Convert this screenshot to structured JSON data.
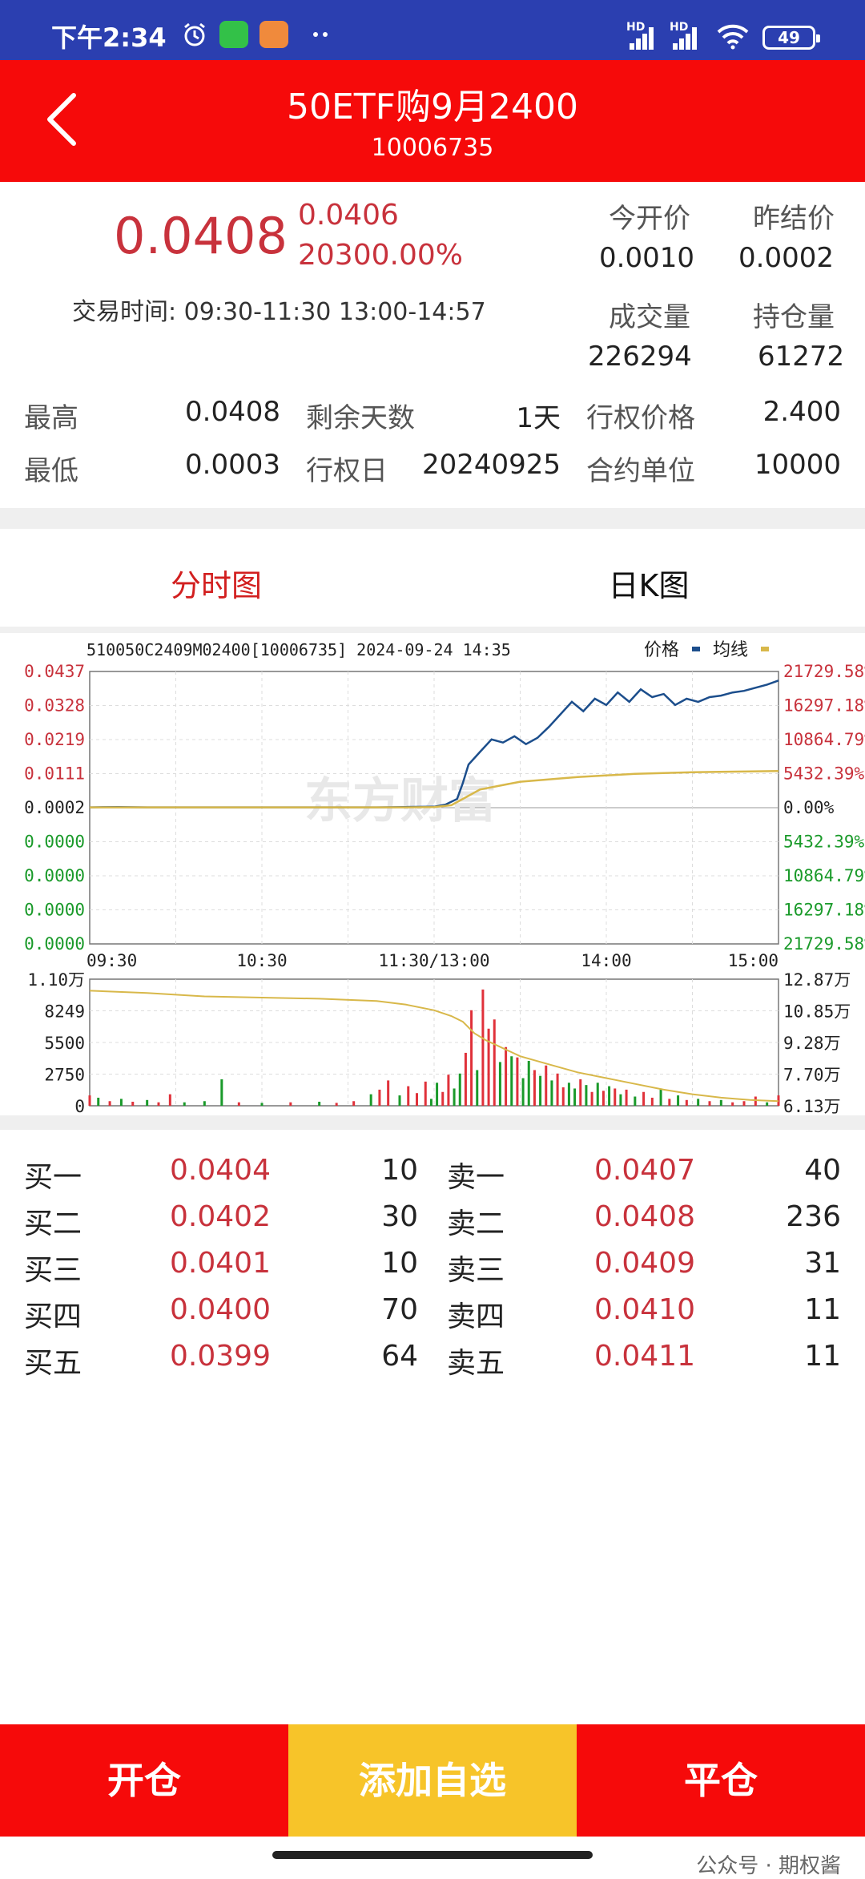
{
  "status_bar": {
    "time": "下午2:34",
    "battery": "49",
    "hd1": "HD",
    "hd2": "HD"
  },
  "header": {
    "title": "50ETF购9月2400",
    "code": "10006735"
  },
  "quote": {
    "price": "0.0408",
    "change": "0.0406",
    "change_pct": "20300.00%",
    "trade_time_label": "交易时间:",
    "trade_time": "09:30-11:30 13:00-14:57",
    "open_label": "今开价",
    "open": "0.0010",
    "prev_settle_label": "昨结价",
    "prev_settle": "0.0002",
    "volume_label": "成交量",
    "volume": "226294",
    "oi_label": "持仓量",
    "oi": "61272",
    "high_label": "最高",
    "high": "0.0408",
    "low_label": "最低",
    "low": "0.0003",
    "days_left_label": "剩余天数",
    "days_left": "1天",
    "exercise_date_label": "行权日",
    "exercise_date": "20240925",
    "strike_label": "行权价格",
    "strike": "2.400",
    "unit_label": "合约单位",
    "unit": "10000"
  },
  "tabs": {
    "intraday": "分时图",
    "daily": "日K图"
  },
  "chart_header": "510050C2409M02400[10006735] 2024-09-24 14:35",
  "legend": {
    "price": "价格",
    "avg": "均线"
  },
  "watermark": "东方财富",
  "chart_data": [
    {
      "type": "line",
      "title": "510050C2409M02400[10006735] 2024-09-24 14:35",
      "x_ticks": [
        "09:30",
        "10:30",
        "11:30/13:00",
        "14:00",
        "15:00"
      ],
      "y_left_ticks": [
        "0.0437",
        "0.0328",
        "0.0219",
        "0.0111",
        "0.0002",
        "0.0000",
        "0.0000",
        "0.0000",
        "0.0000"
      ],
      "y_right_ticks": [
        "21729.58%",
        "16297.18%",
        "10864.79%",
        "5432.39%",
        "0.00%",
        "5432.39%",
        "10864.79%",
        "16297.18%",
        "21729.58%"
      ],
      "ylim": [
        -0.0433,
        0.0437
      ],
      "x_minutes_range": [
        0,
        240
      ],
      "series": [
        {
          "name": "价格",
          "color": "#1c4e8c",
          "x": [
            0,
            10,
            20,
            40,
            60,
            80,
            100,
            110,
            120,
            124,
            128,
            130,
            132,
            136,
            140,
            144,
            148,
            152,
            156,
            160,
            164,
            168,
            172,
            176,
            180,
            184,
            188,
            192,
            196,
            200,
            204,
            208,
            212,
            216,
            220,
            224,
            228,
            232,
            236,
            240
          ],
          "values": [
            0.0003,
            0.0004,
            0.0003,
            0.0003,
            0.0003,
            0.0003,
            0.0003,
            0.0004,
            0.0005,
            0.0012,
            0.003,
            0.008,
            0.014,
            0.018,
            0.022,
            0.021,
            0.023,
            0.0205,
            0.0225,
            0.026,
            0.03,
            0.034,
            0.031,
            0.035,
            0.033,
            0.037,
            0.034,
            0.038,
            0.0355,
            0.0365,
            0.033,
            0.035,
            0.034,
            0.0355,
            0.036,
            0.037,
            0.0375,
            0.0385,
            0.0395,
            0.0408
          ]
        },
        {
          "name": "均线",
          "color": "#d8b84a",
          "x": [
            0,
            40,
            80,
            110,
            120,
            126,
            130,
            136,
            150,
            170,
            190,
            210,
            230,
            240
          ],
          "values": [
            0.0003,
            0.0003,
            0.0003,
            0.0003,
            0.0004,
            0.001,
            0.003,
            0.006,
            0.0085,
            0.01,
            0.011,
            0.0115,
            0.0118,
            0.0119
          ]
        }
      ]
    },
    {
      "type": "bar",
      "y_left_ticks": [
        "1.10万",
        "8249",
        "5500",
        "2750",
        "0"
      ],
      "y_right_ticks": [
        "12.87万",
        "10.85万",
        "9.28万",
        "7.70万",
        "6.13万"
      ],
      "ylim": [
        0,
        11000
      ],
      "bars": [
        {
          "x": 0,
          "v": 900,
          "c": "red"
        },
        {
          "x": 3,
          "v": 700,
          "c": "green"
        },
        {
          "x": 7,
          "v": 400,
          "c": "red"
        },
        {
          "x": 11,
          "v": 600,
          "c": "green"
        },
        {
          "x": 15,
          "v": 350,
          "c": "red"
        },
        {
          "x": 20,
          "v": 500,
          "c": "green"
        },
        {
          "x": 24,
          "v": 300,
          "c": "red"
        },
        {
          "x": 28,
          "v": 1000,
          "c": "red"
        },
        {
          "x": 33,
          "v": 300,
          "c": "green"
        },
        {
          "x": 40,
          "v": 400,
          "c": "green"
        },
        {
          "x": 46,
          "v": 2300,
          "c": "green"
        },
        {
          "x": 52,
          "v": 300,
          "c": "red"
        },
        {
          "x": 60,
          "v": 250,
          "c": "green"
        },
        {
          "x": 70,
          "v": 300,
          "c": "red"
        },
        {
          "x": 80,
          "v": 350,
          "c": "green"
        },
        {
          "x": 86,
          "v": 250,
          "c": "red"
        },
        {
          "x": 92,
          "v": 400,
          "c": "red"
        },
        {
          "x": 98,
          "v": 1000,
          "c": "green"
        },
        {
          "x": 101,
          "v": 1400,
          "c": "red"
        },
        {
          "x": 104,
          "v": 2200,
          "c": "red"
        },
        {
          "x": 108,
          "v": 900,
          "c": "green"
        },
        {
          "x": 111,
          "v": 1700,
          "c": "red"
        },
        {
          "x": 114,
          "v": 1100,
          "c": "red"
        },
        {
          "x": 117,
          "v": 2100,
          "c": "red"
        },
        {
          "x": 119,
          "v": 600,
          "c": "green"
        },
        {
          "x": 121,
          "v": 2000,
          "c": "green"
        },
        {
          "x": 123,
          "v": 1200,
          "c": "red"
        },
        {
          "x": 125,
          "v": 2700,
          "c": "red"
        },
        {
          "x": 127,
          "v": 1500,
          "c": "green"
        },
        {
          "x": 129,
          "v": 2800,
          "c": "green"
        },
        {
          "x": 131,
          "v": 4600,
          "c": "red"
        },
        {
          "x": 133,
          "v": 8300,
          "c": "red"
        },
        {
          "x": 135,
          "v": 3100,
          "c": "green"
        },
        {
          "x": 137,
          "v": 10100,
          "c": "red"
        },
        {
          "x": 139,
          "v": 6700,
          "c": "red"
        },
        {
          "x": 141,
          "v": 7500,
          "c": "red"
        },
        {
          "x": 143,
          "v": 3800,
          "c": "green"
        },
        {
          "x": 145,
          "v": 5100,
          "c": "red"
        },
        {
          "x": 147,
          "v": 4300,
          "c": "green"
        },
        {
          "x": 149,
          "v": 4200,
          "c": "red"
        },
        {
          "x": 151,
          "v": 2400,
          "c": "green"
        },
        {
          "x": 153,
          "v": 3900,
          "c": "green"
        },
        {
          "x": 155,
          "v": 3100,
          "c": "red"
        },
        {
          "x": 157,
          "v": 2600,
          "c": "green"
        },
        {
          "x": 159,
          "v": 3500,
          "c": "red"
        },
        {
          "x": 161,
          "v": 2200,
          "c": "green"
        },
        {
          "x": 163,
          "v": 2800,
          "c": "red"
        },
        {
          "x": 165,
          "v": 1600,
          "c": "red"
        },
        {
          "x": 167,
          "v": 2000,
          "c": "green"
        },
        {
          "x": 169,
          "v": 1500,
          "c": "green"
        },
        {
          "x": 171,
          "v": 2300,
          "c": "red"
        },
        {
          "x": 173,
          "v": 1800,
          "c": "green"
        },
        {
          "x": 175,
          "v": 1200,
          "c": "red"
        },
        {
          "x": 177,
          "v": 2000,
          "c": "green"
        },
        {
          "x": 179,
          "v": 1300,
          "c": "red"
        },
        {
          "x": 181,
          "v": 1700,
          "c": "green"
        },
        {
          "x": 183,
          "v": 1500,
          "c": "red"
        },
        {
          "x": 185,
          "v": 1000,
          "c": "green"
        },
        {
          "x": 187,
          "v": 1400,
          "c": "red"
        },
        {
          "x": 190,
          "v": 800,
          "c": "green"
        },
        {
          "x": 193,
          "v": 1200,
          "c": "red"
        },
        {
          "x": 196,
          "v": 700,
          "c": "red"
        },
        {
          "x": 199,
          "v": 1500,
          "c": "green"
        },
        {
          "x": 202,
          "v": 600,
          "c": "red"
        },
        {
          "x": 205,
          "v": 900,
          "c": "green"
        },
        {
          "x": 208,
          "v": 500,
          "c": "red"
        },
        {
          "x": 212,
          "v": 600,
          "c": "green"
        },
        {
          "x": 216,
          "v": 400,
          "c": "red"
        },
        {
          "x": 220,
          "v": 500,
          "c": "green"
        },
        {
          "x": 224,
          "v": 300,
          "c": "red"
        },
        {
          "x": 228,
          "v": 400,
          "c": "red"
        },
        {
          "x": 232,
          "v": 800,
          "c": "red"
        },
        {
          "x": 236,
          "v": 300,
          "c": "green"
        },
        {
          "x": 240,
          "v": 900,
          "c": "red"
        }
      ],
      "line": {
        "name": "持仓量",
        "color": "#d8b84a",
        "x": [
          0,
          20,
          40,
          60,
          80,
          100,
          110,
          120,
          126,
          130,
          134,
          138,
          144,
          150,
          160,
          170,
          180,
          190,
          200,
          210,
          220,
          230,
          240
        ],
        "values": [
          10000,
          9800,
          9500,
          9400,
          9300,
          9100,
          8800,
          8300,
          7800,
          7300,
          6300,
          5700,
          5000,
          4300,
          3600,
          2900,
          2400,
          1900,
          1400,
          1000,
          700,
          500,
          400
        ]
      }
    }
  ],
  "orderbook": {
    "bids": [
      {
        "label": "买一",
        "price": "0.0404",
        "qty": "10"
      },
      {
        "label": "买二",
        "price": "0.0402",
        "qty": "30"
      },
      {
        "label": "买三",
        "price": "0.0401",
        "qty": "10"
      },
      {
        "label": "买四",
        "price": "0.0400",
        "qty": "70"
      },
      {
        "label": "买五",
        "price": "0.0399",
        "qty": "64"
      }
    ],
    "asks": [
      {
        "label": "卖一",
        "price": "0.0407",
        "qty": "40"
      },
      {
        "label": "卖二",
        "price": "0.0408",
        "qty": "236"
      },
      {
        "label": "卖三",
        "price": "0.0409",
        "qty": "31"
      },
      {
        "label": "卖四",
        "price": "0.0410",
        "qty": "11"
      },
      {
        "label": "卖五",
        "price": "0.0411",
        "qty": "11"
      }
    ]
  },
  "buttons": {
    "open": "开仓",
    "watch": "添加自选",
    "close": "平仓"
  },
  "footer": {
    "wechat": "公众号 · 期权酱"
  },
  "colors": {
    "header": "#f60a0a",
    "status": "#2b3fb0",
    "watch_btn": "#f7c429",
    "up": "#c8323c",
    "down": "#1a9a2a"
  }
}
